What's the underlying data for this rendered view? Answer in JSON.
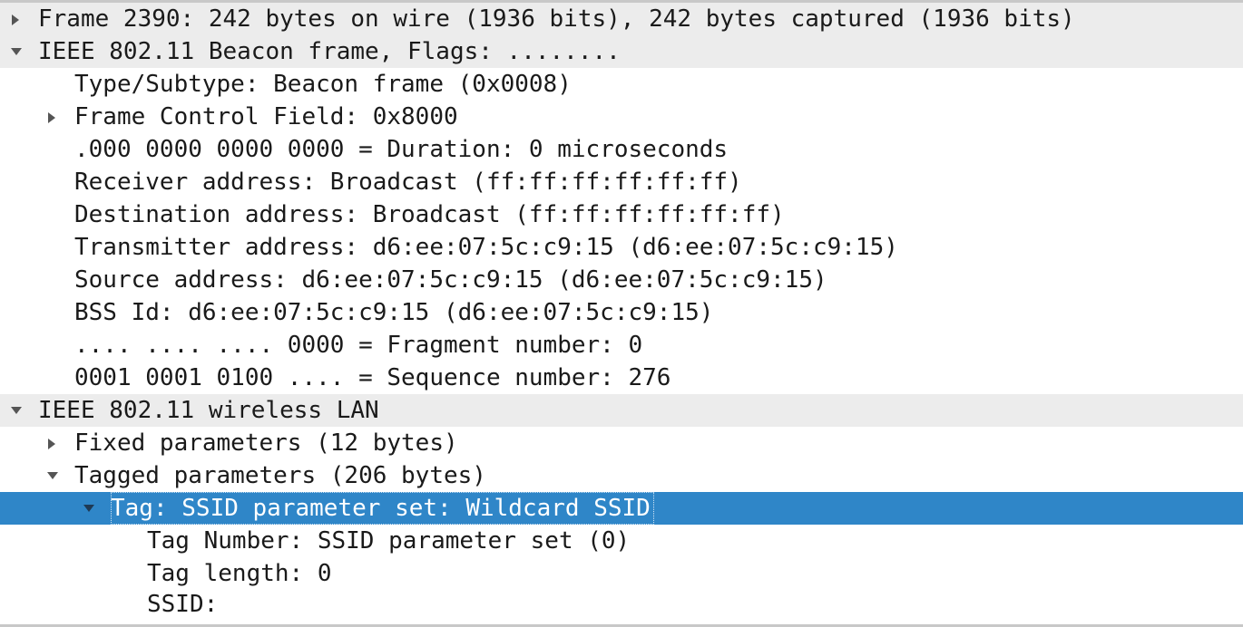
{
  "tree": {
    "frame": "Frame 2390: 242 bytes on wire (1936 bits), 242 bytes captured (1936 bits)",
    "mac_header": "IEEE 802.11 Beacon frame, Flags: ........",
    "type_subtype": "Type/Subtype: Beacon frame (0x0008)",
    "frame_control": "Frame Control Field: 0x8000",
    "duration": ".000 0000 0000 0000 = Duration: 0 microseconds",
    "receiver": "Receiver address: Broadcast (ff:ff:ff:ff:ff:ff)",
    "destination": "Destination address: Broadcast (ff:ff:ff:ff:ff:ff)",
    "transmitter": "Transmitter address: d6:ee:07:5c:c9:15 (d6:ee:07:5c:c9:15)",
    "source": "Source address: d6:ee:07:5c:c9:15 (d6:ee:07:5c:c9:15)",
    "bss_id": "BSS Id: d6:ee:07:5c:c9:15 (d6:ee:07:5c:c9:15)",
    "fragment": ".... .... .... 0000 = Fragment number: 0",
    "sequence": "0001 0001 0100 .... = Sequence number: 276",
    "wlan": "IEEE 802.11 wireless LAN",
    "fixed_params": "Fixed parameters (12 bytes)",
    "tagged_params": "Tagged parameters (206 bytes)",
    "ssid_tag": "Tag: SSID parameter set: Wildcard SSID",
    "tag_number": "Tag Number: SSID parameter set (0)",
    "tag_length": "Tag length: 0",
    "ssid": "SSID:"
  },
  "colors": {
    "selection": "#2f86c8",
    "top_level_row": "#ececec",
    "text": "#1a1a1a"
  },
  "icons": {
    "collapsed": "triangle-right-icon",
    "expanded": "triangle-down-icon"
  }
}
